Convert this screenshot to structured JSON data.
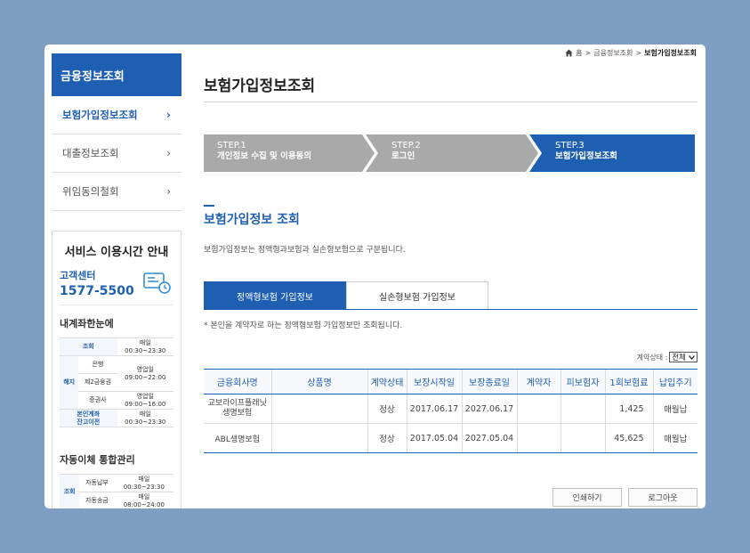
{
  "sidebar": {
    "heading": "금융정보조회",
    "items": [
      {
        "label": "보험가입정보조회"
      },
      {
        "label": "대출정보조회"
      },
      {
        "label": "위임동의철회"
      }
    ]
  },
  "service": {
    "title": "서비스 이용시간 안내",
    "center_label": "고객센터",
    "phone": "1577-5500",
    "section1_title": "내계좌한눈에",
    "section1_rows": [
      {
        "group": "조회",
        "sub": "",
        "time": "매일\n00:30~23:30"
      },
      {
        "group": "해지",
        "sub": "은행",
        "time": "영업일\n09:00~22:00"
      },
      {
        "group": "",
        "sub": "제2금융권",
        "time": ""
      },
      {
        "group": "",
        "sub": "증권사",
        "time": "영업일\n09:00~16:00"
      },
      {
        "group": "본인계좌\n잔고이전",
        "sub": "",
        "time": "매일\n00:30~23:30"
      }
    ],
    "section2_title": "자동이체 통합관리",
    "section2_rows": [
      {
        "group": "조회",
        "sub": "자동납부",
        "time": "매일\n00:30~23:30"
      },
      {
        "group": "",
        "sub": "자동송금",
        "time": "매일\n08:00~24:00"
      }
    ]
  },
  "breadcrumb": {
    "home": "홈",
    "sep": ">",
    "level1": "금융정보조회",
    "current": "보험가입정보조회"
  },
  "page_title": "보험가입정보조회",
  "steps": [
    {
      "num": "STEP.1",
      "label": "개인정보 수집 및 이용동의",
      "state": "done"
    },
    {
      "num": "STEP.2",
      "label": "로그인",
      "state": "done"
    },
    {
      "num": "STEP.3",
      "label": "보험가입정보조회",
      "state": "current"
    }
  ],
  "section": {
    "title": "보험가입정보 조회",
    "description": "보험가입정보는 정액형과보험과 실손형보험으로 구분됩니다."
  },
  "tabs": [
    {
      "label": "정액형보험 가입정보",
      "active": true
    },
    {
      "label": "실손형보험 가입정보",
      "active": false
    }
  ],
  "note": "* 본인을 계약자로 하는 정액형보험 가입정보만 조회됩니다.",
  "filter": {
    "label": "계약상태 :",
    "selected": "전체"
  },
  "table": {
    "headers": [
      "금융회사명",
      "상품명",
      "계약상태",
      "보장시작일",
      "보장종료일",
      "계약자",
      "피보험자",
      "1회보험료",
      "납입주기"
    ],
    "rows": [
      [
        "교보라이프플래닛\n생명보험",
        "",
        "정상",
        "2017.06.17",
        "2027.06.17",
        "",
        "",
        "1,425",
        "매월납"
      ],
      [
        "ABL생명보험",
        "",
        "정상",
        "2017.05.04",
        "2027.05.04",
        "",
        "",
        "45,625",
        "매월납"
      ]
    ]
  },
  "buttons": {
    "print": "인쇄하기",
    "logout": "로그아웃"
  },
  "colors": {
    "primary": "#1f5fb2",
    "step_done": "#a9a9a9",
    "background": "#7e9ec3"
  }
}
